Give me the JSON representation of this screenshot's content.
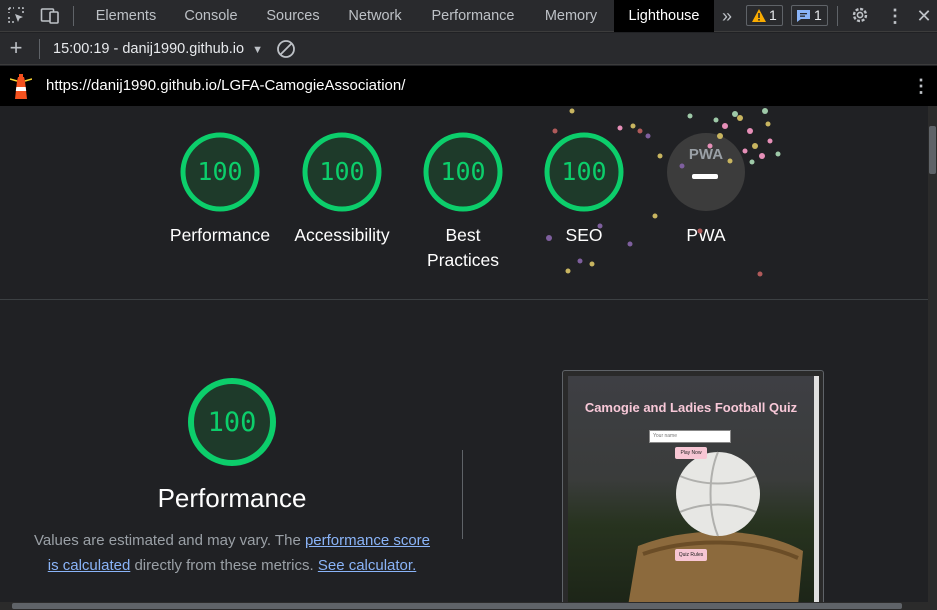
{
  "devtools": {
    "tabs": [
      "Elements",
      "Console",
      "Sources",
      "Network",
      "Performance",
      "Memory",
      "Lighthouse"
    ],
    "active_tab": "Lighthouse",
    "warnings_count": "1",
    "messages_count": "1"
  },
  "report_bar": {
    "report_selector": "15:00:19 - danij1990.github.io"
  },
  "url_bar": {
    "url": "https://danij1990.github.io/LGFA-CamogieAssociation/"
  },
  "summary": {
    "gauges": [
      {
        "score": "100",
        "label": "Performance"
      },
      {
        "score": "100",
        "label": "Accessibility"
      },
      {
        "score": "100",
        "label": "Best Practices",
        "line1": "Best",
        "line2": "Practices"
      },
      {
        "score": "100",
        "label": "SEO"
      }
    ],
    "pwa": {
      "badge": "PWA",
      "label": "PWA"
    }
  },
  "performance": {
    "score": "100",
    "title": "Performance",
    "desc_before": "Values are estimated and may vary. The ",
    "link_score_line1": "performance score",
    "link_score_line2": "is calculated",
    "desc_middle": " directly from these metrics. ",
    "link_calculator": "See calculator."
  },
  "screenshot": {
    "title": "Camogie and Ladies Football Quiz",
    "input_placeholder": "Your name",
    "play_button": "Play Now",
    "rules_button": "Quiz Rules"
  },
  "colors": {
    "pass_green": "#0cce6b",
    "gauge_fill": "#1e3a2a",
    "link_blue": "#8ab4f8",
    "lighthouse_orange": "#f4511e"
  }
}
